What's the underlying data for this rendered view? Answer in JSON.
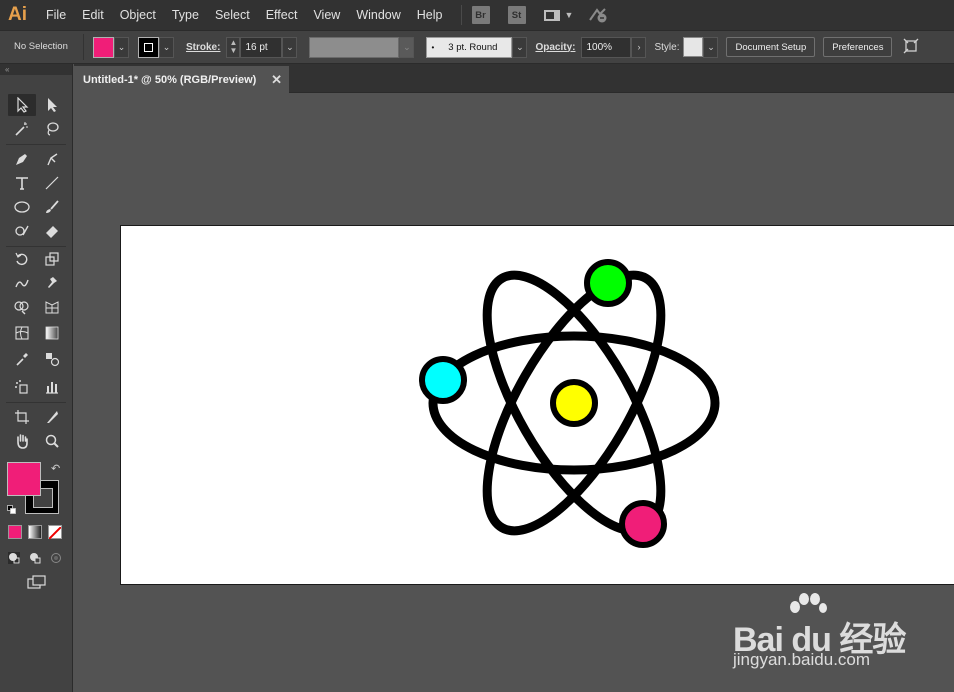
{
  "app": {
    "logo": "Ai"
  },
  "menu": [
    "File",
    "Edit",
    "Object",
    "Type",
    "Select",
    "Effect",
    "View",
    "Window",
    "Help"
  ],
  "menubar_icons": {
    "bridge": "Br",
    "stock": "St"
  },
  "control": {
    "selection": "No Selection",
    "stroke_label": "Stroke:",
    "stroke_weight": "16 pt",
    "brush": "3 pt. Round",
    "opacity_label": "Opacity:",
    "opacity": "100%",
    "style_label": "Style:",
    "document_setup": "Document Setup",
    "preferences": "Preferences"
  },
  "document": {
    "tab_title": "Untitled-1* @ 50% (RGB/Preview)"
  },
  "colors": {
    "fill": "#f01e78",
    "stroke": "#000000",
    "electron_green": "#00ff00",
    "electron_cyan": "#00ffff",
    "electron_magenta": "#f01e78",
    "nucleus": "#ffff00"
  },
  "watermark": {
    "brand": "Bai du 经验",
    "url": "jingyan.baidu.com"
  }
}
